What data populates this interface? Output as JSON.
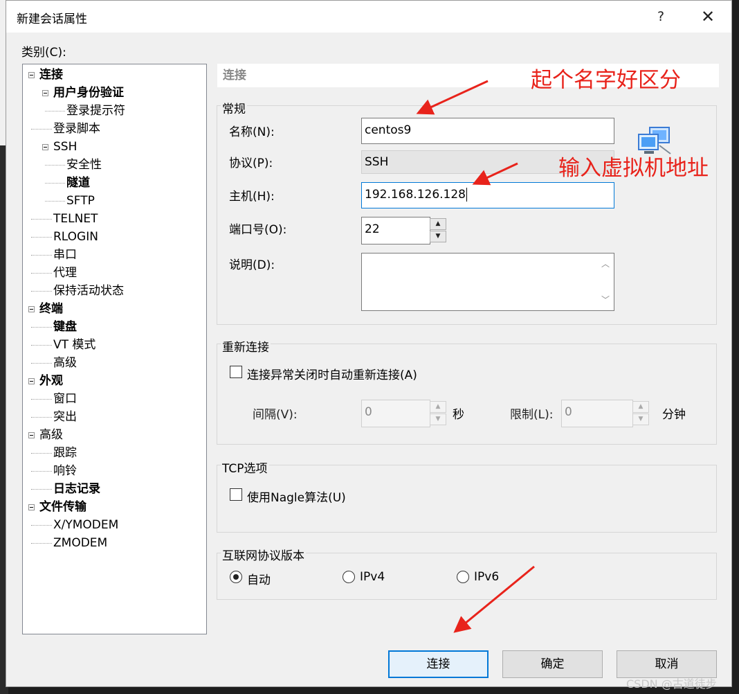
{
  "dialog": {
    "title": "新建会话属性",
    "help": "?",
    "close": "✕"
  },
  "category": {
    "label": "类别(C):",
    "accel": "C"
  },
  "tree": [
    {
      "label": "连接",
      "depth": 0,
      "bold": true,
      "expander": true,
      "selected": true
    },
    {
      "label": "用户身份验证",
      "depth": 1,
      "bold": true,
      "expander": true
    },
    {
      "label": "登录提示符",
      "depth": 2,
      "bold": false
    },
    {
      "label": "登录脚本",
      "depth": 1,
      "bold": false
    },
    {
      "label": "SSH",
      "depth": 1,
      "bold": false,
      "expander": true
    },
    {
      "label": "安全性",
      "depth": 2,
      "bold": false
    },
    {
      "label": "隧道",
      "depth": 2,
      "bold": true
    },
    {
      "label": "SFTP",
      "depth": 2,
      "bold": false
    },
    {
      "label": "TELNET",
      "depth": 1,
      "bold": false
    },
    {
      "label": "RLOGIN",
      "depth": 1,
      "bold": false
    },
    {
      "label": "串口",
      "depth": 1,
      "bold": false
    },
    {
      "label": "代理",
      "depth": 1,
      "bold": false
    },
    {
      "label": "保持活动状态",
      "depth": 1,
      "bold": false
    },
    {
      "label": "终端",
      "depth": 0,
      "bold": true,
      "expander": true
    },
    {
      "label": "键盘",
      "depth": 1,
      "bold": true
    },
    {
      "label": "VT 模式",
      "depth": 1,
      "bold": false
    },
    {
      "label": "高级",
      "depth": 1,
      "bold": false
    },
    {
      "label": "外观",
      "depth": 0,
      "bold": true,
      "expander": true
    },
    {
      "label": "窗口",
      "depth": 1,
      "bold": false
    },
    {
      "label": "突出",
      "depth": 1,
      "bold": false
    },
    {
      "label": "高级",
      "depth": 0,
      "bold": false,
      "expander": true
    },
    {
      "label": "跟踪",
      "depth": 1,
      "bold": false
    },
    {
      "label": "响铃",
      "depth": 1,
      "bold": false
    },
    {
      "label": "日志记录",
      "depth": 1,
      "bold": true
    },
    {
      "label": "文件传输",
      "depth": 0,
      "bold": true,
      "expander": true
    },
    {
      "label": "X/YMODEM",
      "depth": 1,
      "bold": false
    },
    {
      "label": "ZMODEM",
      "depth": 1,
      "bold": false
    }
  ],
  "section_header": "连接",
  "general": {
    "title": "常规",
    "name_label": "名称(N):",
    "name_value": "centos9",
    "protocol_label": "协议(P):",
    "protocol_value": "SSH",
    "host_label": "主机(H):",
    "host_value": "192.168.126.128",
    "port_label": "端口号(O):",
    "port_value": "22",
    "desc_label": "说明(D):",
    "desc_value": ""
  },
  "reconnect": {
    "title": "重新连接",
    "checkbox_label": "连接异常关闭时自动重新连接(A)",
    "checked": false,
    "interval_label": "间隔(V):",
    "interval_value": "0",
    "interval_unit": "秒",
    "limit_label": "限制(L):",
    "limit_value": "0",
    "limit_unit": "分钟"
  },
  "tcp": {
    "title": "TCP选项",
    "nagle_label": "使用Nagle算法(U)",
    "checked": false
  },
  "ipver": {
    "title": "互联网协议版本",
    "options": [
      {
        "label": "自动",
        "selected": true
      },
      {
        "label": "IPv4",
        "selected": false
      },
      {
        "label": "IPv6",
        "selected": false
      }
    ]
  },
  "buttons": {
    "connect": "连接",
    "ok": "确定",
    "cancel": "取消"
  },
  "annotations": {
    "name_hint": "起个名字好区分",
    "host_hint": "输入虚拟机地址",
    "color": "#e8231b"
  },
  "watermark": "CSDN @古道徒步"
}
